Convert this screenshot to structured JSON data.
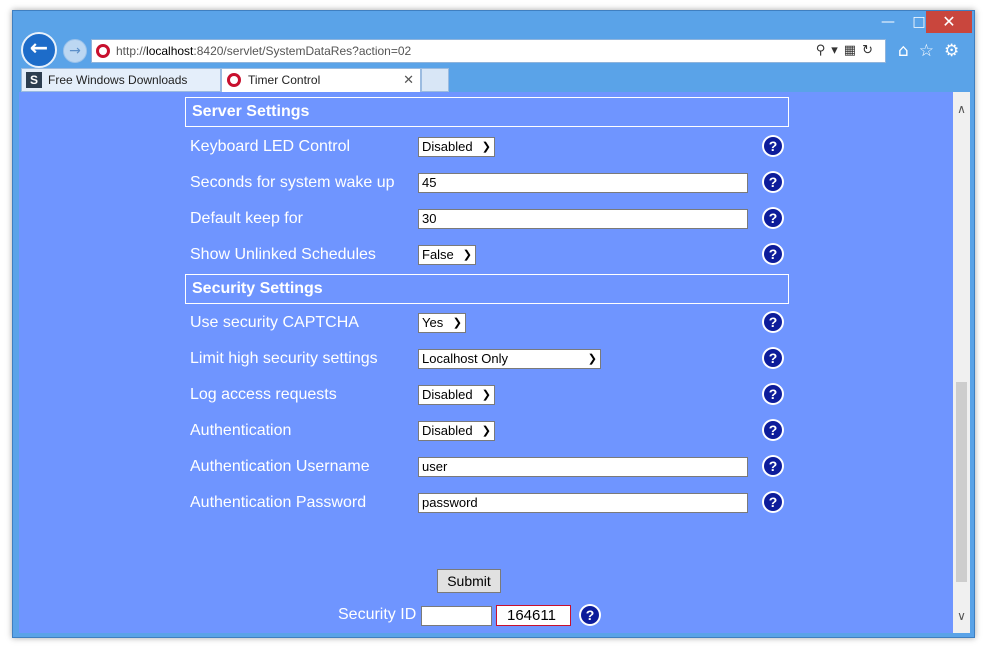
{
  "browser": {
    "url_prefix": "http://",
    "url_host": "localhost",
    "url_rest": ":8420/servlet/SystemDataRes?action=02",
    "tabs": [
      {
        "label": "Free Windows Downloads"
      },
      {
        "label": "Timer Control"
      }
    ]
  },
  "sections": {
    "server": "Server Settings",
    "security": "Security Settings"
  },
  "server_settings": {
    "keyboard_led": {
      "label": "Keyboard LED Control",
      "value": "Disabled"
    },
    "wake_seconds": {
      "label": "Seconds for system wake up",
      "value": "45"
    },
    "keep_for": {
      "label": "Default keep for",
      "value": "30"
    },
    "unlinked": {
      "label": "Show Unlinked Schedules",
      "value": "False"
    }
  },
  "security_settings": {
    "captcha": {
      "label": "Use security CAPTCHA",
      "value": "Yes"
    },
    "limit": {
      "label": "Limit high security settings",
      "value": "Localhost Only"
    },
    "log_access": {
      "label": "Log access requests",
      "value": "Disabled"
    },
    "auth": {
      "label": "Authentication",
      "value": "Disabled"
    },
    "username": {
      "label": "Authentication Username",
      "value": "user"
    },
    "password": {
      "label": "Authentication Password",
      "value": "password"
    }
  },
  "help_glyph": "?",
  "submit_label": "Submit",
  "security_id": {
    "label": "Security ID",
    "input_value": "",
    "captcha_code": "164611"
  },
  "colors": {
    "page_bg": "#6f95ff",
    "help_icon": "#0d1c9a",
    "captcha_border": "#c8102e"
  }
}
